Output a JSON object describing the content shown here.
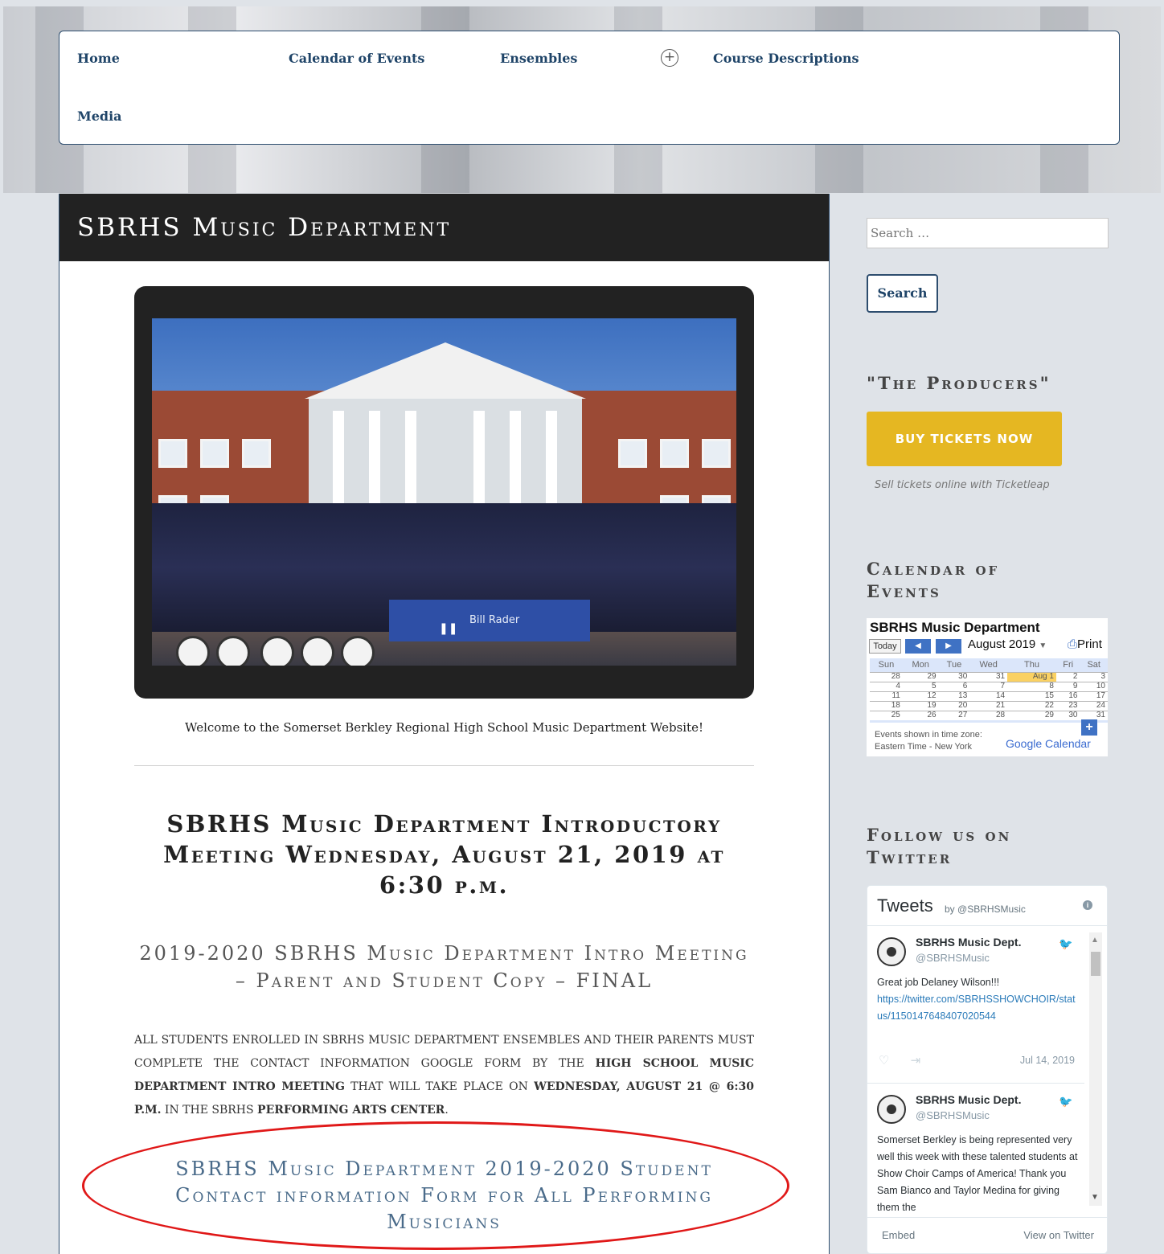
{
  "nav": {
    "items": [
      "Home",
      "Calendar of Events",
      "Ensembles",
      "Course Descriptions",
      "Media"
    ],
    "expand_icon": "plus-circle-icon"
  },
  "main": {
    "title": "SBRHS Music Department",
    "slider": {
      "banner_text": "Bill Rader",
      "pause_icon": "pause-icon"
    },
    "welcome": "Welcome to the Somerset Berkley Regional High School Music Department Website!",
    "meeting_heading": "SBRHS Music Department Introductory Meeting Wednesday, August 21, 2019 at 6:30 p.m.",
    "intro_link": "2019-2020 SBRHS Music Department Intro Meeting – Parent and Student Copy – FINAL",
    "notice": {
      "part1": "All students enrolled in SBRHS Music Department Ensembles and their parents must complete the contact information Google form by the ",
      "bold1": "High School Music Department Intro Meeting",
      "part2": " that will take place on ",
      "bold2": "Wednesday, August 21 @ 6:30 p.m.",
      "part3": " in the SBRHS ",
      "bold3": "Performing Arts Center",
      "part4": "."
    },
    "form_link": "SBRHS Music Department 2019-2020 Student Contact information Form for All Performing Musicians"
  },
  "sidebar": {
    "search_placeholder": "Search …",
    "search_button": "Search",
    "producers_title": "\"The Producers\"",
    "buy_button": "Buy Tickets Now",
    "sell_text": "Sell tickets online with Ticketleap",
    "calendar_title": "Calendar of Events",
    "calendar": {
      "name": "SBRHS Music Department",
      "today_label": "Today",
      "month": "August 2019",
      "print_label": "Print",
      "weekdays": [
        "Sun",
        "Mon",
        "Tue",
        "Wed",
        "Thu",
        "Fri",
        "Sat"
      ],
      "weeks": [
        [
          "28",
          "29",
          "30",
          "31",
          "Aug 1",
          "2",
          "3"
        ],
        [
          "4",
          "5",
          "6",
          "7",
          "8",
          "9",
          "10"
        ],
        [
          "11",
          "12",
          "13",
          "14",
          "15",
          "16",
          "17"
        ],
        [
          "18",
          "19",
          "20",
          "21",
          "22",
          "23",
          "24"
        ],
        [
          "25",
          "26",
          "27",
          "28",
          "29",
          "30",
          "31"
        ]
      ],
      "timezone_line1": "Events shown in time zone:",
      "timezone_line2": "Eastern Time - New York",
      "brand": "Google Calendar"
    },
    "twitter_title": "Follow us on Twitter",
    "twitter": {
      "header": "Tweets",
      "by": "by @SBRHSMusic",
      "tweets": [
        {
          "name": "SBRHS Music Dept.",
          "handle": "@SBRHSMusic",
          "text": "Great job Delaney Wilson!!!",
          "link": "https://twitter.com/SBRHSSHOWCHOIR/status/1150147648407020544",
          "date": "Jul 14, 2019"
        },
        {
          "name": "SBRHS Music Dept.",
          "handle": "@SBRHSMusic",
          "text": "Somerset Berkley is being represented very well this week with these talented students at Show Choir Camps of America! Thank you Sam Bianco and Taylor Medina for giving them the"
        }
      ],
      "embed": "Embed",
      "view": "View on Twitter"
    }
  },
  "colors": {
    "nav_border": "#2d4d6e",
    "header_bg": "#222222",
    "buy_button": "#e5b722",
    "annotation_ellipse": "#e01818"
  }
}
